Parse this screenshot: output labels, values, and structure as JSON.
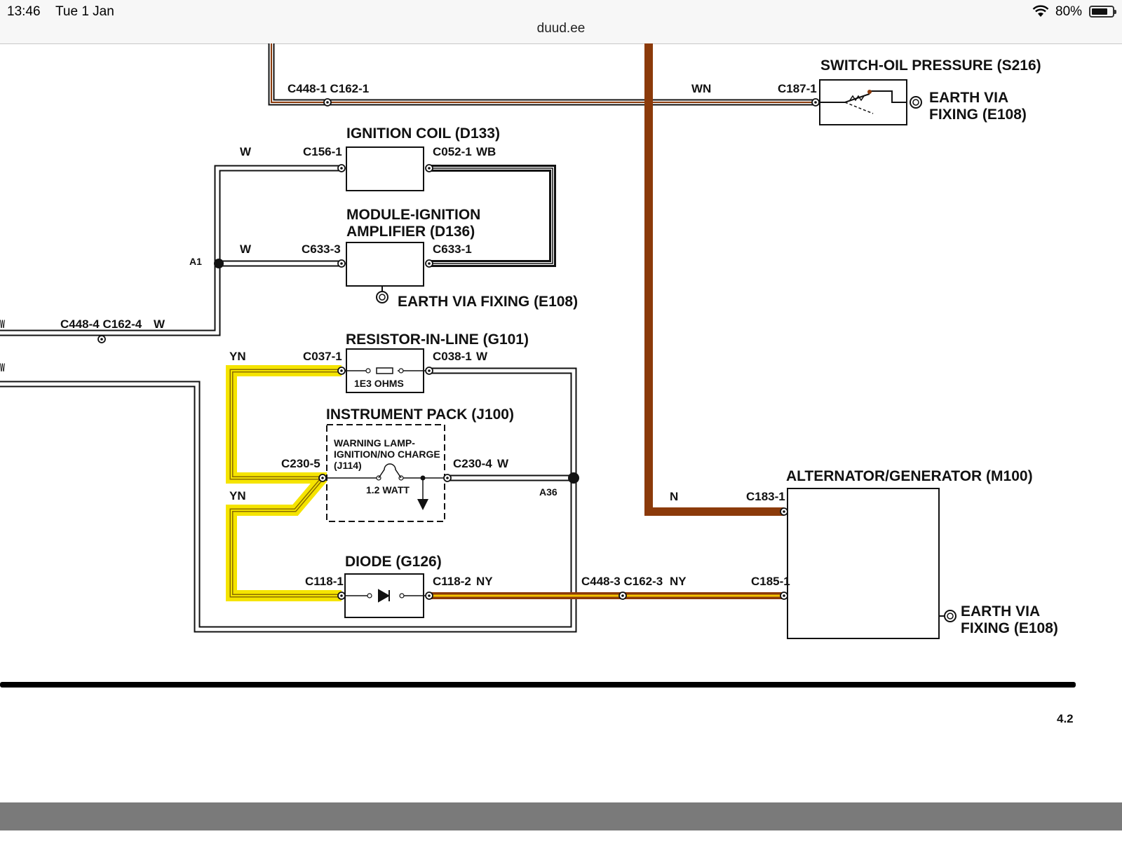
{
  "status_bar": {
    "time": "13:46",
    "date": "Tue 1 Jan",
    "url": "duud.ee",
    "battery_percent": "80%",
    "battery_level": 0.8,
    "wifi_icon": "wifi-icon",
    "battery_icon": "battery-icon"
  },
  "colors": {
    "brown_wire": "#8b3a0a",
    "yellow_highlight": "#f5e400",
    "wire_outline": "#111111"
  },
  "components": {
    "oil_switch": "SWITCH-OIL PRESSURE (S216)",
    "ignition_coil": "IGNITION COIL (D133)",
    "module_line1": "MODULE-IGNITION",
    "module_line2": "AMPLIFIER (D136)",
    "resistor": "RESISTOR-IN-LINE (G101)",
    "resistor_value": "1E3 OHMS",
    "instrument_pack": "INSTRUMENT PACK (J100)",
    "lamp_line1": "WARNING LAMP-",
    "lamp_line2": "IGNITION/NO CHARGE",
    "lamp_line3": "(J114)",
    "lamp_watt": "1.2 WATT",
    "diode": "DIODE (G126)",
    "alternator": "ALTERNATOR/GENERATOR (M100)"
  },
  "earth": {
    "oil_line1": "EARTH VIA",
    "oil_line2": "FIXING (E108)",
    "module": "EARTH VIA FIXING (E108)",
    "alt_line1": "EARTH VIA",
    "alt_line2": "FIXING (E108)"
  },
  "connectors": {
    "c448_1": "C448-1 C162-1",
    "c187_1": "C187-1",
    "c156_1": "C156-1",
    "c052_1": "C052-1",
    "c633_3": "C633-3",
    "c633_1": "C633-1",
    "c448_4": "C448-4 C162-4",
    "c037_1": "C037-1",
    "c038_1": "C038-1",
    "c230_5": "C230-5",
    "c230_4": "C230-4",
    "c118_1": "C118-1",
    "c118_2": "C118-2",
    "c448_3": "C448-3 C162-3",
    "c183_1": "C183-1",
    "c185_1": "C185-1"
  },
  "wire_colors": {
    "wn": "WN",
    "w_coil": "W",
    "wb": "WB",
    "w_module": "W",
    "w_c448_4": "W",
    "w_left_top": "W",
    "w_left_bottom": "W",
    "yn_top": "YN",
    "w_resistor": "W",
    "w_pack": "W",
    "yn_bottom": "YN",
    "ny_diode": "NY",
    "ny_harness": "NY",
    "n": "N"
  },
  "splices": {
    "a1": "A1",
    "a36": "A36"
  },
  "page_number": "4.2"
}
